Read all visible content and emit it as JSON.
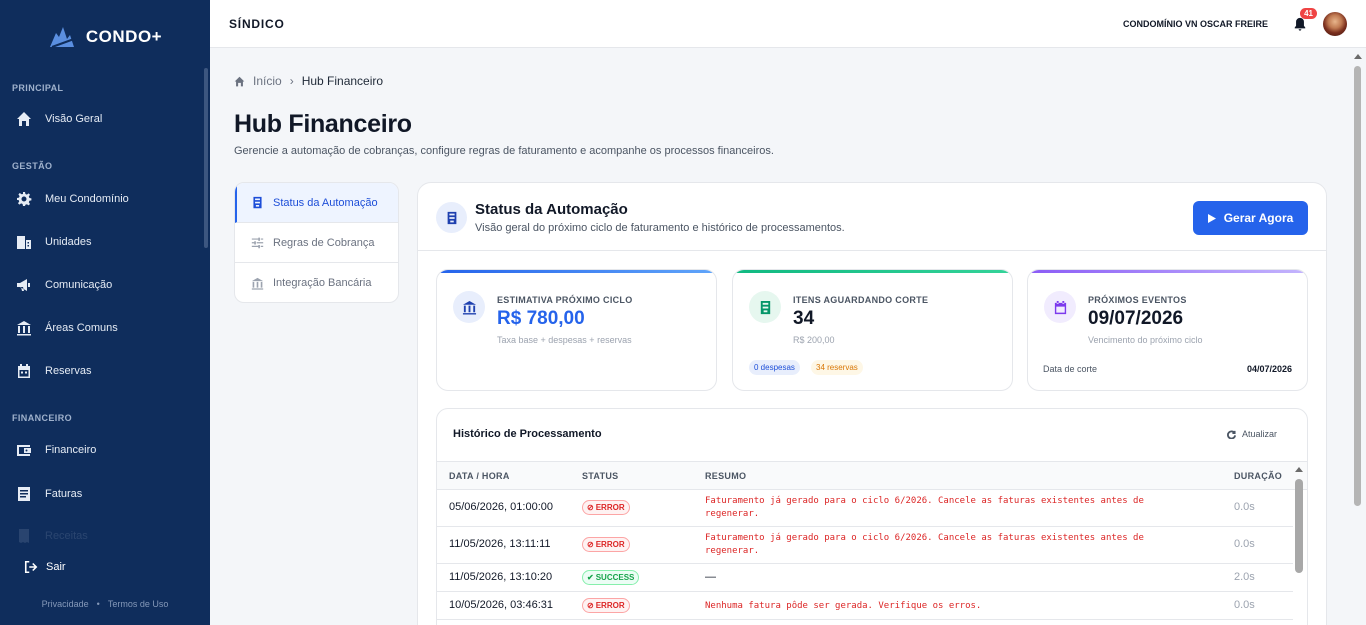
{
  "brand": {
    "name": "CONDO+"
  },
  "sidebar": {
    "sections": {
      "principal": "PRINCIPAL",
      "gestao": "GESTÃO",
      "financeiro": "FINANCEIRO"
    },
    "items": [
      {
        "label": "Visão Geral",
        "icon": "home-icon"
      },
      {
        "label": "Meu Condomínio",
        "icon": "gear-icon"
      },
      {
        "label": "Unidades",
        "icon": "building-icon"
      },
      {
        "label": "Comunicação",
        "icon": "megaphone-icon"
      },
      {
        "label": "Áreas Comuns",
        "icon": "columns-icon"
      },
      {
        "label": "Reservas",
        "icon": "calendar-icon"
      },
      {
        "label": "Financeiro",
        "icon": "wallet-icon"
      },
      {
        "label": "Faturas",
        "icon": "invoice-icon"
      },
      {
        "label": "Receitas",
        "icon": "receipt-icon"
      }
    ],
    "logout": "Sair",
    "footer": {
      "privacy": "Privacidade",
      "separator": "•",
      "terms": "Termos de Uso"
    }
  },
  "topbar": {
    "role": "SÍNDICO",
    "condo": "CONDOMÍNIO VN OSCAR FREIRE",
    "notifications": "41"
  },
  "breadcrumb": {
    "home": "Início",
    "separator": "›",
    "current": "Hub Financeiro"
  },
  "page": {
    "title": "Hub Financeiro",
    "subtitle": "Gerencie a automação de cobranças, configure regras de faturamento e acompanhe os processos financeiros."
  },
  "tabs": [
    {
      "label": "Status da Automação",
      "active": true
    },
    {
      "label": "Regras de Cobrança",
      "active": false
    },
    {
      "label": "Integração Bancária",
      "active": false
    }
  ],
  "status": {
    "title": "Status da Automação",
    "subtitle": "Visão geral do próximo ciclo de faturamento e histórico de processamentos.",
    "button": "Gerar Agora"
  },
  "cards": {
    "estimate": {
      "label": "ESTIMATIVA PRÓXIMO CICLO",
      "value": "R$ 780,00",
      "note": "Taxa base + despesas + reservas",
      "color": "#2563eb"
    },
    "pending": {
      "label": "ITENS AGUARDANDO CORTE",
      "value": "34",
      "note": "R$ 200,00",
      "chip_expenses": "0 despesas",
      "chip_reservations": "34 reservas",
      "color": "#10b981"
    },
    "events": {
      "label": "PRÓXIMOS EVENTOS",
      "value": "09/07/2026",
      "note": "Vencimento do próximo ciclo",
      "cut_label": "Data de corte",
      "cut_date": "04/07/2026",
      "color": "#8b5cf6"
    }
  },
  "history": {
    "title": "Histórico de Processamento",
    "refresh": "Atualizar",
    "columns": {
      "date": "DATA / HORA",
      "status": "STATUS",
      "summary": "RESUMO",
      "duration": "DURAÇÃO"
    },
    "rows": [
      {
        "date": "05/06/2026, 01:00:00",
        "status": "ERROR",
        "summary": "Faturamento já gerado para o ciclo 6/2026. Cancele as faturas existentes antes de regenerar.",
        "duration": "0.0s"
      },
      {
        "date": "11/05/2026, 13:11:11",
        "status": "ERROR",
        "summary": "Faturamento já gerado para o ciclo 6/2026. Cancele as faturas existentes antes de regenerar.",
        "duration": "0.0s"
      },
      {
        "date": "11/05/2026, 13:10:20",
        "status": "SUCCESS",
        "summary": "—",
        "duration": "2.0s"
      },
      {
        "date": "10/05/2026, 03:46:31",
        "status": "ERROR",
        "summary": "Nenhuma fatura pôde ser gerada. Verifique os erros.",
        "duration": "0.0s"
      }
    ]
  },
  "colors": {
    "sidebar": "#0f2d5c",
    "primary": "#2563eb",
    "error": "#dc2626",
    "success": "#16a34a"
  }
}
